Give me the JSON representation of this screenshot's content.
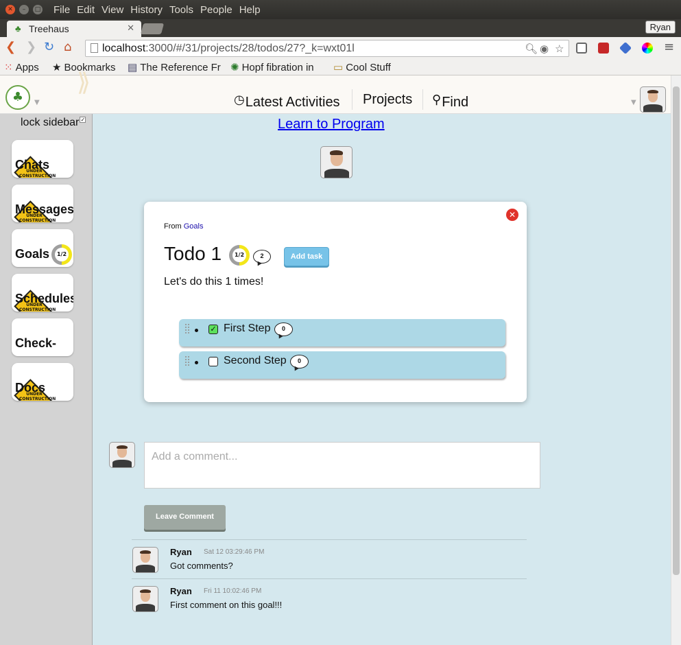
{
  "os": {
    "menu": [
      "File",
      "Edit",
      "View",
      "History",
      "Tools",
      "People",
      "Help"
    ]
  },
  "browser": {
    "tab_title": "Treehaus",
    "profile": "Ryan",
    "url_host": "localhost",
    "url_rest": ":3000/#/31/projects/28/todos/27?_k=wxt01l",
    "bookmarks": [
      {
        "icon": "apps-grid-icon",
        "label": "Apps"
      },
      {
        "icon": "star-icon",
        "label": "Bookmarks"
      },
      {
        "icon": "page-icon",
        "label": "The Reference Fr"
      },
      {
        "icon": "flower-icon",
        "label": "Hopf fibration in"
      },
      {
        "icon": "folder-icon",
        "label": "Cool Stuff"
      }
    ]
  },
  "header": {
    "nav": [
      "Latest Activities",
      "Projects",
      "Find"
    ]
  },
  "sidebar": {
    "lock_label": "lock sidebar",
    "items": [
      {
        "label": "Chats",
        "badge": "under-construction"
      },
      {
        "label": "Messages",
        "badge": "under-construction"
      },
      {
        "label": "Goals",
        "progress": "1/2"
      },
      {
        "label": "Schedules",
        "badge": "under-construction"
      },
      {
        "label": "Check-",
        "badge": ""
      },
      {
        "label": "Docs",
        "badge": "under-construction"
      }
    ],
    "under_construction_text": "UNDER CONSTRUCTION"
  },
  "main": {
    "course_link": "Learn to Program",
    "card": {
      "from_label": "From",
      "from_link": "Goals",
      "title": "Todo 1",
      "progress": "1/2",
      "progress_fraction": 0.5,
      "comment_count": "2",
      "add_task_label": "Add task",
      "description": "Let's do this 1 times!",
      "steps": [
        {
          "label": "First Step",
          "checked": true,
          "comments": "0"
        },
        {
          "label": "Second Step",
          "checked": false,
          "comments": "0"
        }
      ]
    },
    "comment_placeholder": "Add a comment...",
    "leave_comment_label": "Leave Comment",
    "comments": [
      {
        "author": "Ryan",
        "time": "Sat 12 03:29:46 PM",
        "body": "Got comments?"
      },
      {
        "author": "Ryan",
        "time": "Fri 11 10:02:46 PM",
        "body": "First comment on this goal!!!"
      }
    ]
  },
  "colors": {
    "page_bg": "#d5e8ee",
    "step_bg": "#add8e6",
    "progress_yellow": "#f3e61a",
    "add_task": "#77c3e8",
    "close_red": "#e0322a"
  }
}
